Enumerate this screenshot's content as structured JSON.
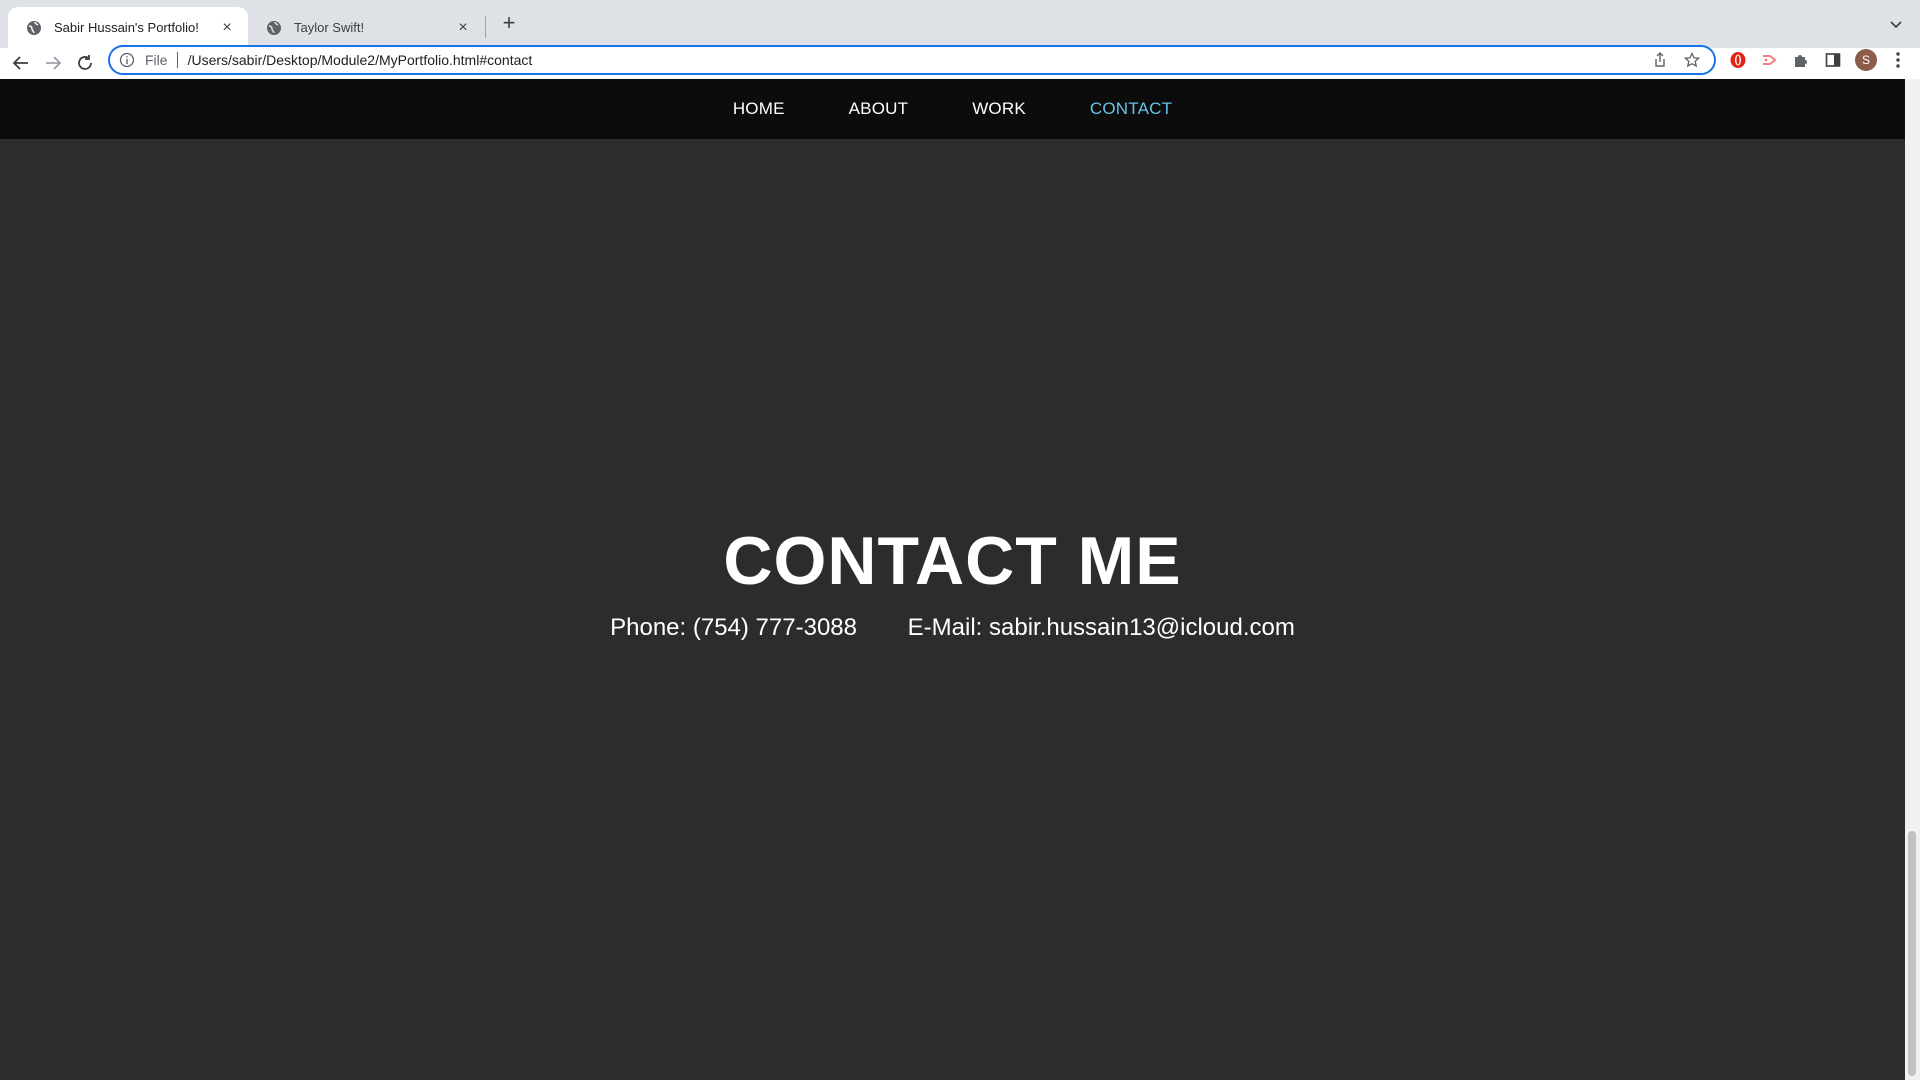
{
  "browser": {
    "tabs": [
      {
        "title": "Sabir Hussain's Portfolio!",
        "active": true
      },
      {
        "title": "Taylor Swift!",
        "active": false
      }
    ],
    "address": {
      "scheme_label": "File",
      "url": "/Users/sabir/Desktop/Module2/MyPortfolio.html#contact"
    },
    "profile_initial": "S"
  },
  "site": {
    "nav": [
      {
        "label": "HOME",
        "active": false
      },
      {
        "label": "ABOUT",
        "active": false
      },
      {
        "label": "WORK",
        "active": false
      },
      {
        "label": "CONTACT",
        "active": true
      }
    ],
    "contact": {
      "title": "CONTACT ME",
      "phone": "Phone: (754) 777-3088",
      "email": "E-Mail: sabir.hussain13@icloud.com"
    }
  },
  "colors": {
    "nav_bg": "#0c0c0c",
    "page_bg": "#2c2c2c",
    "nav_active": "#66c2e8",
    "omnibox_focus": "#1a73e8"
  }
}
